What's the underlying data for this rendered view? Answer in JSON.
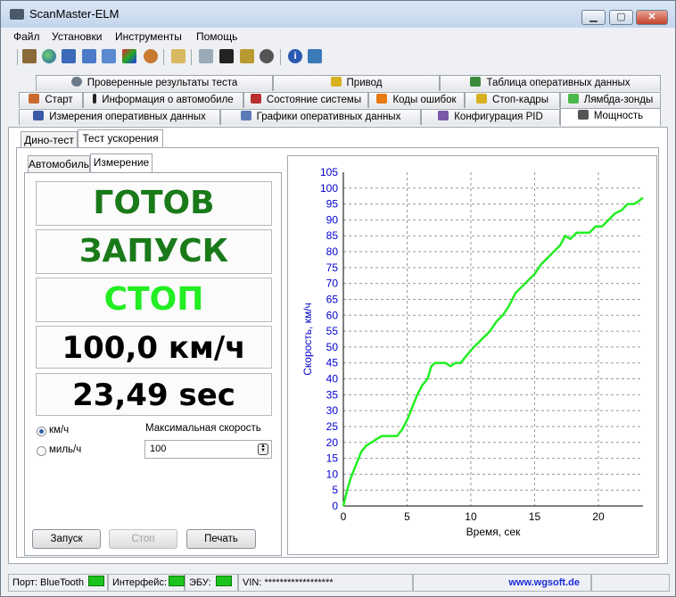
{
  "window": {
    "title": "ScanMaster-ELM",
    "controls": {
      "minimize": "▁",
      "maximize": "▢",
      "close": "✕"
    }
  },
  "menu": [
    "Файл",
    "Установки",
    "Инструменты",
    "Помощь"
  ],
  "tabs": {
    "row1": [
      "Проверенные результаты теста",
      "Привод",
      "Таблица оперативных данных"
    ],
    "row2": [
      "Старт",
      "Информация о автомобиле",
      "Состояние системы",
      "Коды ошибок",
      "Стоп-кадры",
      "Лямбда-зонды"
    ],
    "row3": [
      "Измерения оперативных данных",
      "Графики оперативных данных",
      "Конфигурация PID",
      "Мощность"
    ]
  },
  "subtabs": [
    "Дино-тест",
    "Тест ускорения"
  ],
  "inner_tabs": [
    "Автомобиль",
    "Измерение"
  ],
  "measure": {
    "ready": "ГОТОВ",
    "start": "ЗАПУСК",
    "stop": "СТОП",
    "speed": "100,0 км/ч",
    "time": "23,49 sec",
    "unit_kmh": "км/ч",
    "unit_mph": "миль/ч",
    "max_speed_label": "Максимальная скорость",
    "max_speed_value": "100",
    "btn_start": "Запуск",
    "btn_stop": "Стоп",
    "btn_print": "Печать"
  },
  "colors": {
    "ready": "#1a7a1a",
    "start": "#1a7a1a",
    "stop": "#22ee22",
    "line": "#22ee22",
    "axis_text": "#0000cc"
  },
  "chart_data": {
    "type": "line",
    "xlabel": "Время, сек",
    "ylabel": "Скорость, км/ч",
    "xlim": [
      0,
      23.5
    ],
    "ylim": [
      0,
      105
    ],
    "xticks": [
      0,
      5,
      10,
      15,
      20
    ],
    "yticks": [
      0,
      5,
      10,
      15,
      20,
      25,
      30,
      35,
      40,
      45,
      50,
      55,
      60,
      65,
      70,
      75,
      80,
      85,
      90,
      95,
      100,
      105
    ],
    "grid": true,
    "series": [
      {
        "x": [
          0,
          0.3,
          0.6,
          1.0,
          1.4,
          1.8,
          2.2,
          2.6,
          3.0,
          3.4,
          3.8,
          4.2,
          4.6,
          5.0,
          5.4,
          5.8,
          6.2,
          6.6,
          6.9,
          7.2,
          7.6,
          8.0,
          8.4,
          8.8,
          9.2,
          9.6,
          10.0,
          10.5,
          11.0,
          11.5,
          12.0,
          12.5,
          13.0,
          13.5,
          14.0,
          14.5,
          15.0,
          15.5,
          16.0,
          16.5,
          17.0,
          17.4,
          17.8,
          18.3,
          18.8,
          19.3,
          19.8,
          20.3,
          20.8,
          21.3,
          21.8,
          22.3,
          22.8,
          23.2,
          23.49
        ],
        "y": [
          0,
          5,
          9,
          13,
          17,
          19,
          20,
          21,
          22,
          22,
          22,
          22,
          24,
          27,
          31,
          35,
          38,
          40,
          44,
          45,
          45,
          45,
          44,
          45,
          45,
          47,
          49,
          51,
          53,
          55,
          58,
          60,
          63,
          67,
          69,
          71,
          73,
          76,
          78,
          80,
          82,
          85,
          84,
          86,
          86,
          86,
          88,
          88,
          90,
          92,
          93,
          95,
          95,
          96,
          97
        ]
      }
    ]
  },
  "status": {
    "port": "Порт: BlueTooth",
    "interface": "Интерфейс:",
    "ecu": "ЭБУ:",
    "vin": "VIN: ******************",
    "website": "www.wgsoft.de"
  }
}
